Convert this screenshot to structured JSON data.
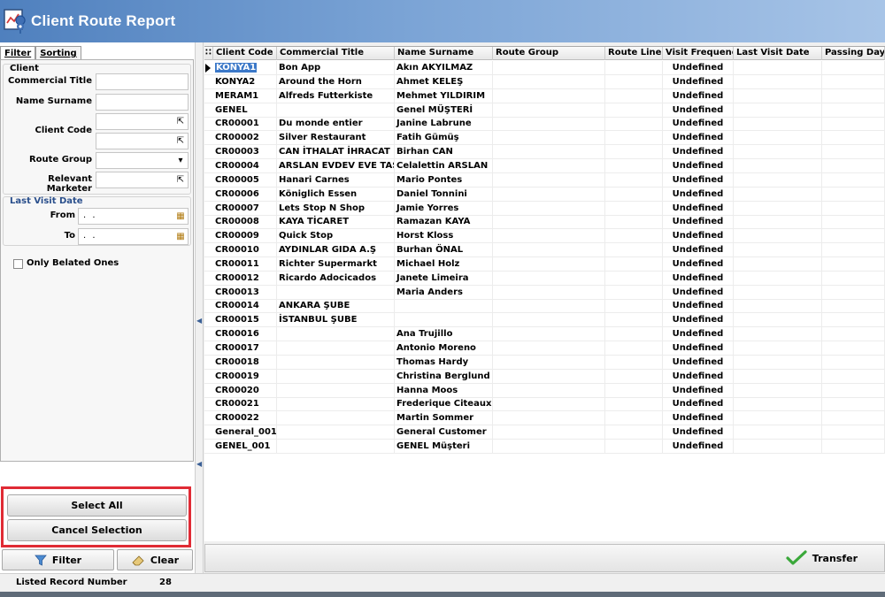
{
  "window": {
    "title": "Client Route Report"
  },
  "tabs": [
    {
      "label": "Filter"
    },
    {
      "label": "Sorting"
    }
  ],
  "filter": {
    "client_group": "Client",
    "commercial_title_label": "Commercial Title",
    "name_surname_label": "Name Surname",
    "client_code_label": "Client Code",
    "route_group_label": "Route Group",
    "relevant_marketer_label": "Relevant Marketer",
    "last_visit_group": "Last Visit Date",
    "from_label": "From",
    "to_label": "To",
    "from_value": ". .",
    "to_value": ". .",
    "only_belated_label": "Only Belated Ones"
  },
  "actions": {
    "select_all": "Select All",
    "cancel_selection": "Cancel Selection",
    "filter": "Filter",
    "clear": "Clear",
    "transfer": "Transfer"
  },
  "status": {
    "label": "Listed Record Number",
    "value": "28"
  },
  "colors": {
    "highlight_border": "#e02b35",
    "selection": "#3b78c8",
    "titlebar": "#4f80be"
  },
  "grid": {
    "columns": [
      {
        "label": "Client Code"
      },
      {
        "label": "Commercial Title"
      },
      {
        "label": "Name Surname"
      },
      {
        "label": "Route Group"
      },
      {
        "label": "Route Line"
      },
      {
        "label": "Visit Frequency"
      },
      {
        "label": "Last Visit Date"
      },
      {
        "label": "Passing Days"
      }
    ],
    "rows": [
      [
        "KONYA1",
        "Bon App",
        "Akın AKYILMAZ",
        "",
        "",
        "Undefined",
        "",
        ""
      ],
      [
        "KONYA2",
        "Around the Horn",
        "Ahmet KELEŞ",
        "",
        "",
        "Undefined",
        "",
        ""
      ],
      [
        "MERAM1",
        "Alfreds Futterkiste",
        "Mehmet YILDIRIM",
        "",
        "",
        "Undefined",
        "",
        ""
      ],
      [
        "GENEL",
        "",
        "Genel MÜŞTERİ",
        "",
        "",
        "Undefined",
        "",
        ""
      ],
      [
        "CR00001",
        "Du monde entier",
        "Janine Labrune",
        "",
        "",
        "Undefined",
        "",
        ""
      ],
      [
        "CR00002",
        "Silver Restaurant",
        "Fatih Gümüş",
        "",
        "",
        "Undefined",
        "",
        ""
      ],
      [
        "CR00003",
        "CAN İTHALAT İHRACAT",
        "Birhan CAN",
        "",
        "",
        "Undefined",
        "",
        ""
      ],
      [
        "CR00004",
        "ARSLAN EVDEV EVE TAŞIMA",
        "Celalettin ARSLAN",
        "",
        "",
        "Undefined",
        "",
        ""
      ],
      [
        "CR00005",
        "Hanari Carnes",
        "Mario Pontes",
        "",
        "",
        "Undefined",
        "",
        ""
      ],
      [
        "CR00006",
        "Königlich Essen",
        "Daniel  Tonnini",
        "",
        "",
        "Undefined",
        "",
        ""
      ],
      [
        "CR00007",
        "Lets Stop N Shop",
        "Jamie  Yorres",
        "",
        "",
        "Undefined",
        "",
        ""
      ],
      [
        "CR00008",
        "KAYA TİCARET",
        "Ramazan KAYA",
        "",
        "",
        "Undefined",
        "",
        ""
      ],
      [
        "CR00009",
        "Quick Stop",
        "Horst Kloss",
        "",
        "",
        "Undefined",
        "",
        ""
      ],
      [
        "CR00010",
        "AYDINLAR GIDA A.Ş",
        "Burhan ÖNAL",
        "",
        "",
        "Undefined",
        "",
        ""
      ],
      [
        "CR00011",
        "Richter Supermarkt",
        "Michael Holz",
        "",
        "",
        "Undefined",
        "",
        ""
      ],
      [
        "CR00012",
        "Ricardo Adocicados",
        "Janete Limeira",
        "",
        "",
        "Undefined",
        "",
        ""
      ],
      [
        "CR00013",
        "",
        "Maria Anders",
        "",
        "",
        "Undefined",
        "",
        ""
      ],
      [
        "CR00014",
        "ANKARA ŞUBE",
        "",
        "",
        "",
        "Undefined",
        "",
        ""
      ],
      [
        "CR00015",
        "İSTANBUL ŞUBE",
        "",
        "",
        "",
        "Undefined",
        "",
        ""
      ],
      [
        "CR00016",
        "",
        "Ana Trujillo",
        "",
        "",
        "Undefined",
        "",
        ""
      ],
      [
        "CR00017",
        "",
        "Antonio  Moreno",
        "",
        "",
        "Undefined",
        "",
        ""
      ],
      [
        "CR00018",
        "",
        "Thomas  Hardy",
        "",
        "",
        "Undefined",
        "",
        ""
      ],
      [
        "CR00019",
        "",
        "Christina Berglund",
        "",
        "",
        "Undefined",
        "",
        ""
      ],
      [
        "CR00020",
        "",
        "Hanna Moos",
        "",
        "",
        "Undefined",
        "",
        ""
      ],
      [
        "CR00021",
        "",
        "Frederique Citeaux",
        "",
        "",
        "Undefined",
        "",
        ""
      ],
      [
        "CR00022",
        "",
        "Martin Sommer",
        "",
        "",
        "Undefined",
        "",
        ""
      ],
      [
        "General_001",
        "",
        "General Customer",
        "",
        "",
        "Undefined",
        "",
        ""
      ],
      [
        "GENEL_001",
        "",
        "GENEL Müşteri",
        "",
        "",
        "Undefined",
        "",
        ""
      ]
    ]
  }
}
